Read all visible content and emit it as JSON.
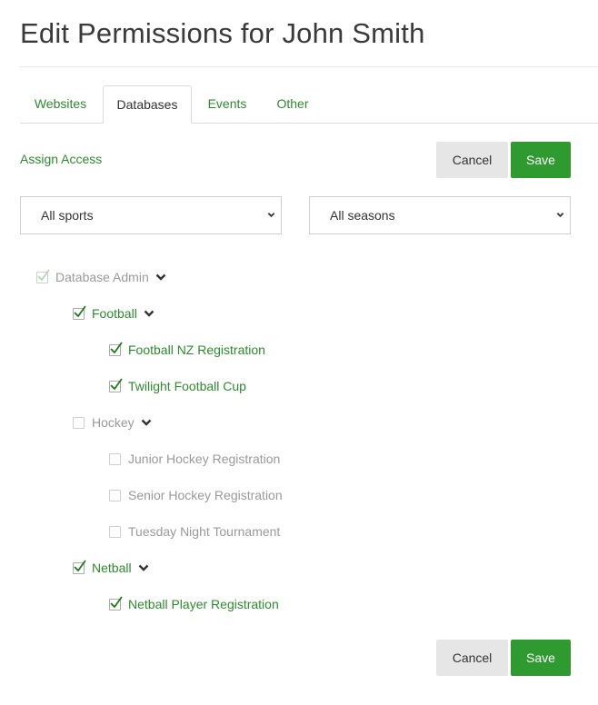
{
  "page": {
    "title": "Edit Permissions for John Smith"
  },
  "tabs": [
    {
      "label": "Websites"
    },
    {
      "label": "Databases"
    },
    {
      "label": "Events"
    },
    {
      "label": "Other"
    }
  ],
  "actions": {
    "assign_access": "Assign Access",
    "cancel_label": "Cancel",
    "save_label": "Save"
  },
  "filters": {
    "sport_selected": "All sports",
    "season_selected": "All seasons"
  },
  "tree": {
    "root": {
      "label": "Database Admin",
      "checked": true,
      "disabled": true
    },
    "groups": [
      {
        "label": "Football",
        "checked": true,
        "items": [
          {
            "label": "Football NZ Registration",
            "checked": true
          },
          {
            "label": "Twilight Football Cup",
            "checked": true
          }
        ]
      },
      {
        "label": "Hockey",
        "checked": false,
        "items": [
          {
            "label": "Junior Hockey Registration",
            "checked": false
          },
          {
            "label": "Senior Hockey Registration",
            "checked": false
          },
          {
            "label": "Tuesday Night Tournament",
            "checked": false
          }
        ]
      },
      {
        "label": "Netball",
        "checked": true,
        "items": [
          {
            "label": "Netball Player Registration",
            "checked": true
          }
        ]
      }
    ]
  },
  "colors": {
    "accent": "#2f9a2f",
    "link": "#2e8b2e",
    "muted": "#9a9a9a",
    "cancel_bg": "#e6e6e6"
  }
}
